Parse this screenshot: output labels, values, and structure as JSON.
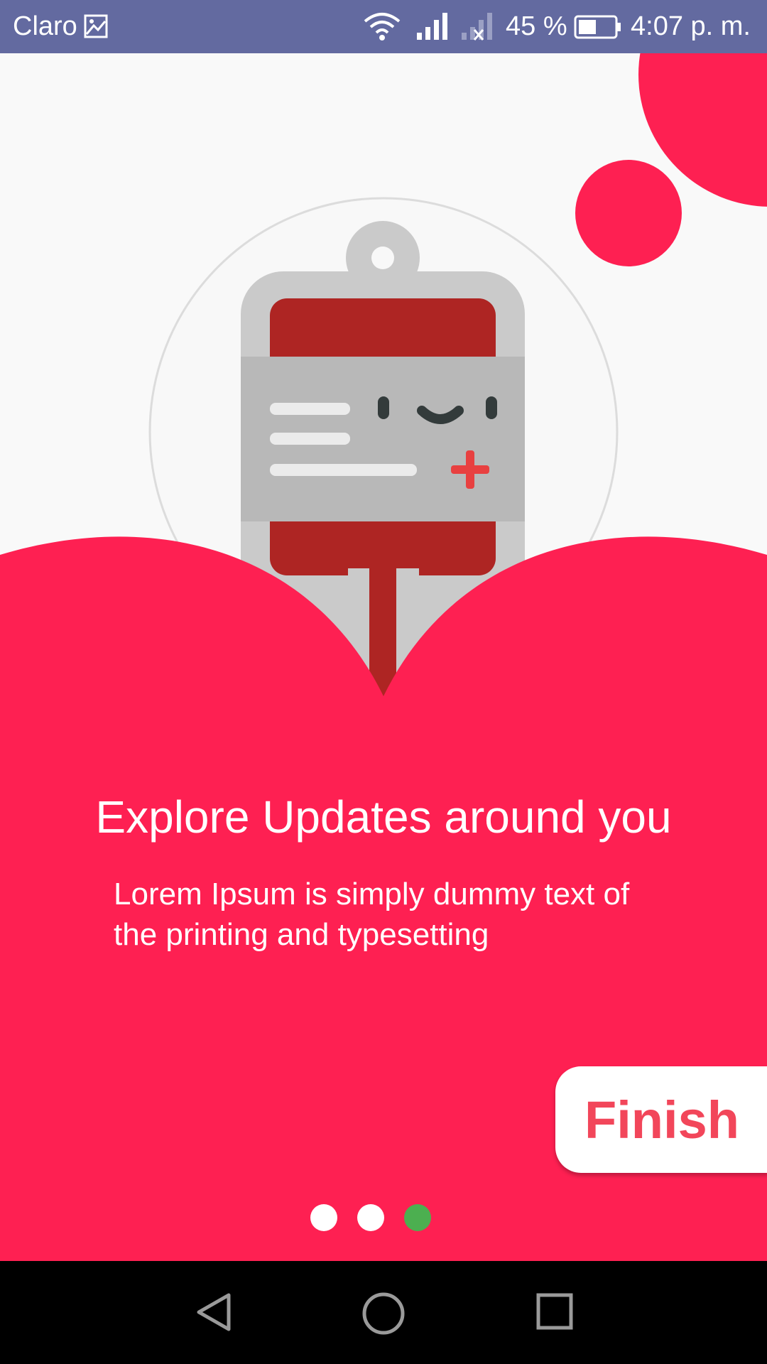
{
  "status_bar": {
    "carrier": "Claro",
    "battery_percent": "45 %",
    "time": "4:07 p. m.",
    "icons": [
      "gallery-icon",
      "wifi-icon",
      "signal-icon",
      "signal-x-icon",
      "battery-icon"
    ]
  },
  "onboarding": {
    "title": "Explore Updates around you",
    "description": "Lorem Ipsum is simply dummy text of the printing and typesetting",
    "finish_label": "Finish",
    "page_indicator": {
      "total": 3,
      "current": 3
    }
  },
  "colors": {
    "status_bar": "#636aa0",
    "accent": "#fe2052",
    "finish_text": "#f2465a",
    "dot_inactive": "#ffffff",
    "dot_active": "#4caf50",
    "blood": "#ae2523",
    "bag_gray": "#cacaca",
    "label_gray": "#b8b8b8"
  },
  "nav_bar": {
    "icons": [
      "back-icon",
      "home-icon",
      "recents-icon"
    ]
  }
}
